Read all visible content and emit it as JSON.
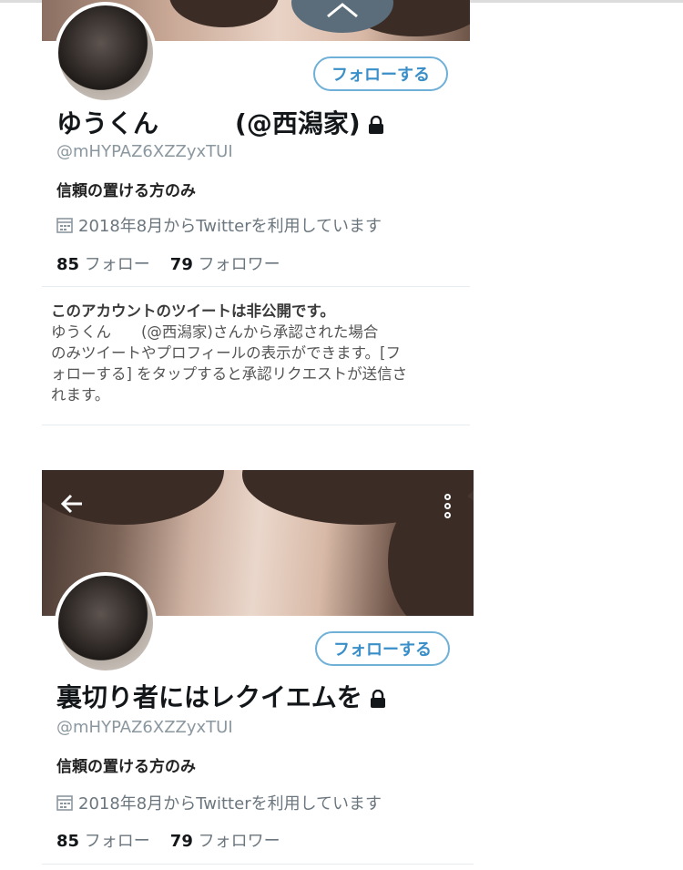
{
  "profiles": [
    {
      "follow_label": "フォローする",
      "display_name": "ゆうくん",
      "display_name_suffix": "(@西潟家)",
      "handle": "@mHYPAZ6XZZyxTUI",
      "bio": "信頼の置ける方のみ",
      "joined": "2018年8月からTwitterを利用しています",
      "following_count": "85",
      "following_label": "フォロー",
      "followers_count": "79",
      "followers_label": "フォロワー",
      "protected_notice": {
        "title": "このアカウントのツイートは非公開です。",
        "line1": "ゆうくん　　(@西潟家)さんから承認された場合",
        "line2": "のみツイートやプロフィールの表示ができます。[フ",
        "line3": "ォローする] をタップすると承認リクエストが送信さ",
        "line4": "れます。"
      }
    },
    {
      "follow_label": "フォローする",
      "display_name": "裏切り者にはレクイエムを",
      "handle": "@mHYPAZ6XZZyxTUI",
      "bio": "信頼の置ける方のみ",
      "joined": "2018年8月からTwitterを利用しています",
      "following_count": "85",
      "following_label": "フォロー",
      "followers_count": "79",
      "followers_label": "フォロワー"
    }
  ],
  "icons": {
    "scroll_up": "chevron-up-icon",
    "back": "arrow-left-icon",
    "more": "more-vertical-icon",
    "lock": "lock-icon",
    "calendar": "calendar-icon"
  },
  "colors": {
    "follow_button": "#3a8fc8",
    "scroll_up_bg": "#5b6d7a",
    "muted_text": "#6b767e"
  }
}
